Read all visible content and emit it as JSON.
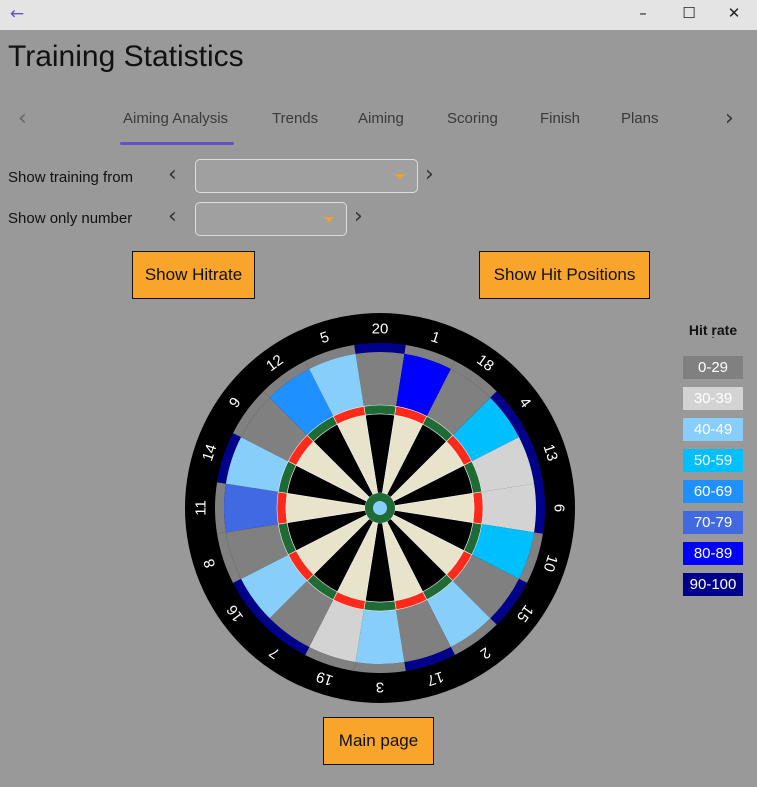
{
  "window": {
    "back_icon": "arrow-left-icon",
    "minimize": "–",
    "maximize": "☐",
    "close": "✕"
  },
  "header": {
    "title": "Training Statistics"
  },
  "tabs": [
    {
      "label": "Aiming Analysis",
      "selected": true
    },
    {
      "label": "Trends"
    },
    {
      "label": "Aiming"
    },
    {
      "label": "Scoring"
    },
    {
      "label": "Finish"
    },
    {
      "label": "Plans"
    }
  ],
  "filters": {
    "training_label": "Show training from",
    "training_value": "",
    "number_label": "Show only number",
    "number_value": ""
  },
  "buttons": {
    "hitrate": "Show Hitrate",
    "hit_positions": "Show Hit Positions",
    "main_page": "Main page"
  },
  "legend": {
    "title": "Hit rate",
    "dot": "·",
    "buckets": [
      {
        "label": "0-29",
        "color": "#808080"
      },
      {
        "label": "30-39",
        "color": "#d3d3d3"
      },
      {
        "label": "40-49",
        "color": "#87cefa"
      },
      {
        "label": "50-59",
        "color": "#00bfff"
      },
      {
        "label": "60-69",
        "color": "#1e90ff"
      },
      {
        "label": "70-79",
        "color": "#4169e1"
      },
      {
        "label": "80-89",
        "color": "#0000ff"
      },
      {
        "label": "90-100",
        "color": "#00008b"
      }
    ]
  },
  "board": {
    "segments": [
      {
        "number": "20",
        "single": 0,
        "double": 7
      },
      {
        "number": "1",
        "single": 6,
        "double": 0
      },
      {
        "number": "18",
        "single": 0,
        "double": 0
      },
      {
        "number": "4",
        "single": 3,
        "double": 7
      },
      {
        "number": "13",
        "single": 1,
        "double": 7
      },
      {
        "number": "6",
        "single": 1,
        "double": 7
      },
      {
        "number": "10",
        "single": 3,
        "double": 0
      },
      {
        "number": "15",
        "single": 0,
        "double": 7
      },
      {
        "number": "2",
        "single": 2,
        "double": 0
      },
      {
        "number": "17",
        "single": 0,
        "double": 7
      },
      {
        "number": "3",
        "single": 2,
        "double": 0
      },
      {
        "number": "19",
        "single": 1,
        "double": 0
      },
      {
        "number": "7",
        "single": 0,
        "double": 7
      },
      {
        "number": "16",
        "single": 2,
        "double": 7
      },
      {
        "number": "8",
        "single": 0,
        "double": 0
      },
      {
        "number": "11",
        "single": 5,
        "double": 0
      },
      {
        "number": "14",
        "single": 2,
        "double": 7
      },
      {
        "number": "9",
        "single": 0,
        "double": 0
      },
      {
        "number": "12",
        "single": 4,
        "double": 0
      },
      {
        "number": "5",
        "single": 2,
        "double": 0
      }
    ],
    "bull_bucket": 2
  }
}
